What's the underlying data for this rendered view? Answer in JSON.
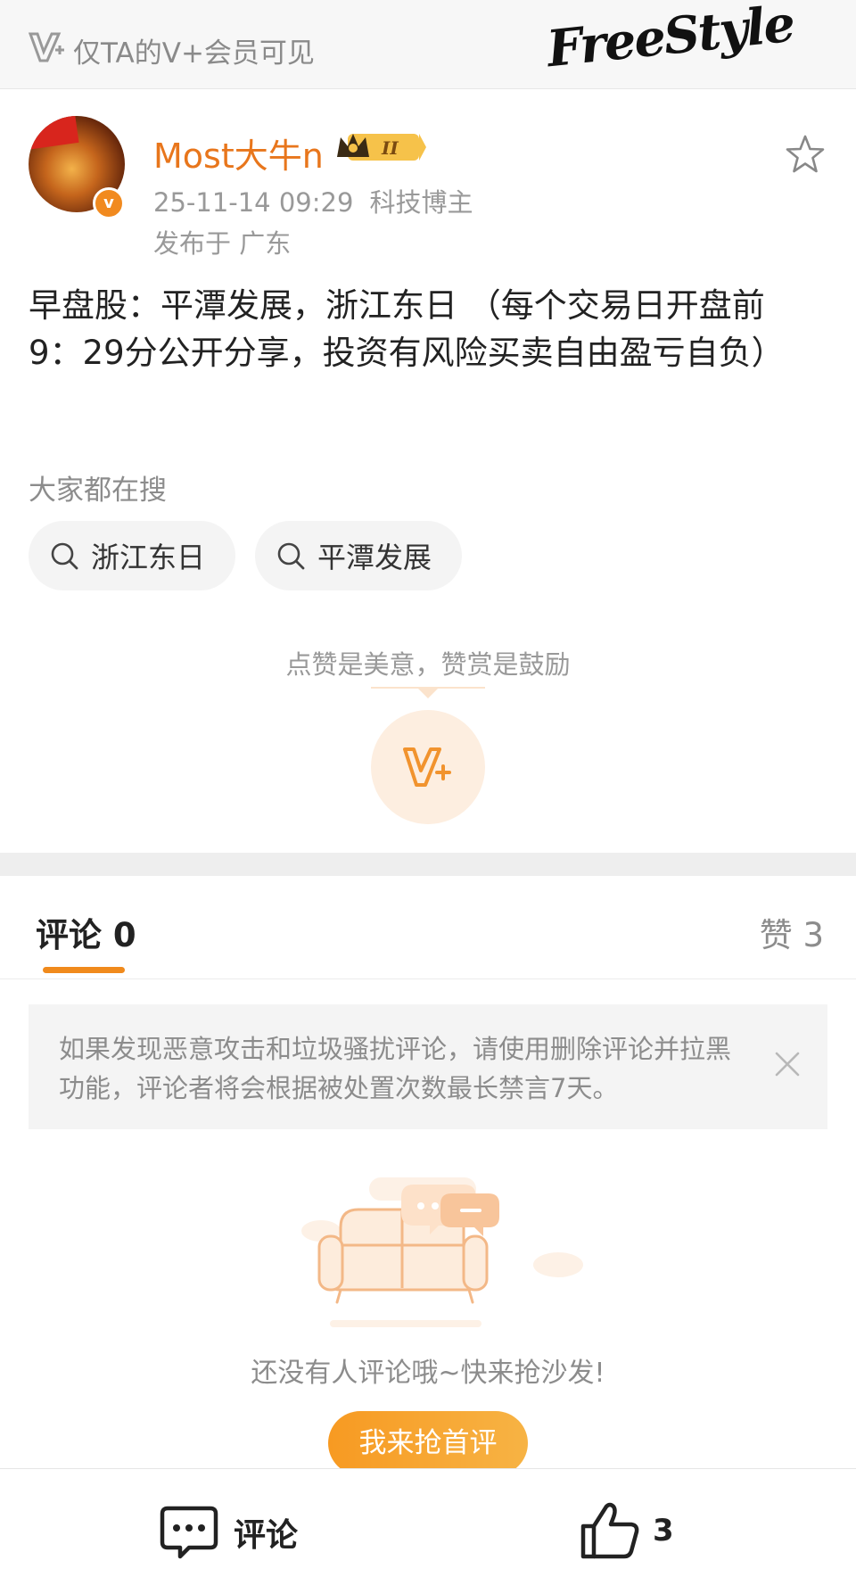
{
  "topbar": {
    "vip_text": "仅TA的V+会员可见",
    "watermark": "FreeStyle"
  },
  "post": {
    "author": "Most大牛n",
    "rank_badge": "II",
    "time": "25-11-14 09:29",
    "category": "科技博主",
    "location": "发布于 广东",
    "content": "早盘股：平潭发展，浙江东日 （每个交易日开盘前9：29分公开分享，投资有风险买卖自由盈亏自负）"
  },
  "search": {
    "title": "大家都在搜",
    "chips": [
      "浙江东日",
      "平潭发展"
    ]
  },
  "reward": {
    "text": "点赞是美意，赞赏是鼓励"
  },
  "tabs": {
    "comments": "评论 0",
    "likes": "赞 3"
  },
  "notice": {
    "text": "如果发现恶意攻击和垃圾骚扰评论，请使用删除评论并拉黑功能，评论者将会根据被处置次数最长禁言7天。"
  },
  "empty": {
    "text": "还没有人评论哦~快来抢沙发!",
    "button": "我来抢首评"
  },
  "bottom_bar": {
    "comment_label": "评论",
    "like_count": "3"
  },
  "colors": {
    "accent": "#f08a1c",
    "username": "#e8761c",
    "muted": "#8c8c8c"
  },
  "icons": [
    "vplus-icon",
    "star-icon",
    "search-icon",
    "close-icon",
    "comment-icon",
    "thumb-up-icon",
    "sofa-illustration"
  ]
}
